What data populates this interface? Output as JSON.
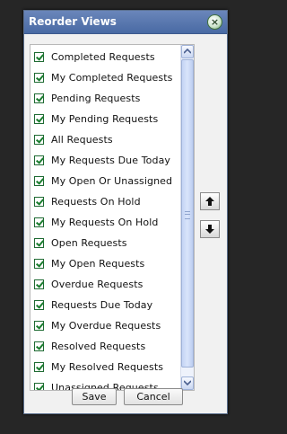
{
  "dialog": {
    "title": "Reorder Views",
    "close_glyph": "×",
    "save_label": "Save",
    "cancel_label": "Cancel"
  },
  "views": [
    {
      "label": "Completed Requests",
      "checked": true
    },
    {
      "label": "My Completed Requests",
      "checked": true
    },
    {
      "label": "Pending Requests",
      "checked": true
    },
    {
      "label": "My Pending Requests",
      "checked": true
    },
    {
      "label": "All Requests",
      "checked": true
    },
    {
      "label": "My Requests Due Today",
      "checked": true
    },
    {
      "label": "My Open Or Unassigned",
      "checked": true
    },
    {
      "label": "Requests On Hold",
      "checked": true
    },
    {
      "label": "My Requests On Hold",
      "checked": true
    },
    {
      "label": "Open Requests",
      "checked": true
    },
    {
      "label": "My Open Requests",
      "checked": true
    },
    {
      "label": "Overdue Requests",
      "checked": true
    },
    {
      "label": "Requests Due Today",
      "checked": true
    },
    {
      "label": "My Overdue Requests",
      "checked": true
    },
    {
      "label": "Resolved Requests",
      "checked": true
    },
    {
      "label": "My Resolved Requests",
      "checked": true
    },
    {
      "label": "Unassigned Requests",
      "checked": true
    }
  ],
  "icons": {
    "move_up": "arrow-up-icon",
    "move_down": "arrow-down-icon",
    "scroll_up": "scroll-up-icon",
    "scroll_down": "scroll-down-icon"
  },
  "colors": {
    "titlebar": "#496aa4",
    "checkbox_check": "#1a7d2e",
    "scrollbar_thumb": "#c4d4f4"
  }
}
